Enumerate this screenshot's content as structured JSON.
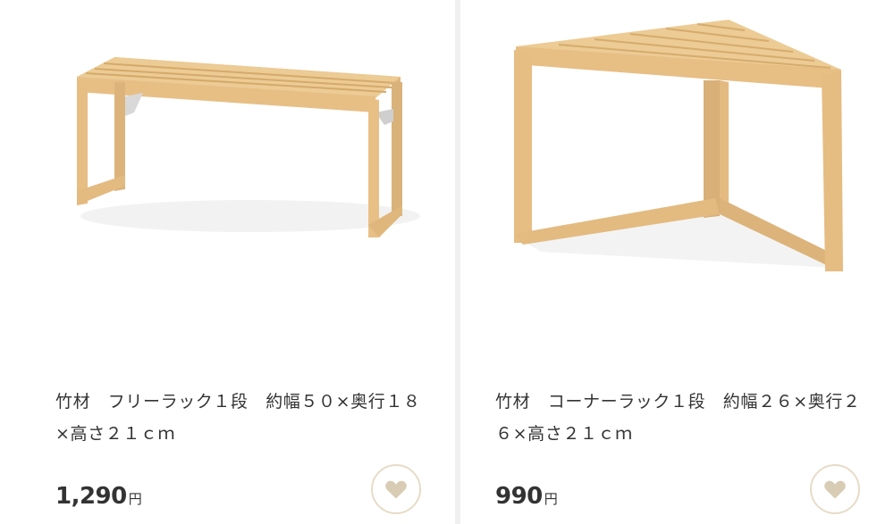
{
  "products": [
    {
      "title": "竹材　フリーラック１段　約幅５０×奥行１８×高さ２１ｃｍ",
      "price": "1,290",
      "currency": "円",
      "image_icon": "bamboo-free-rack-image",
      "favorite_icon": "heart-icon"
    },
    {
      "title": "竹材　コーナーラック１段　約幅２６×奥行２６×高さ２１ｃｍ",
      "price": "990",
      "currency": "円",
      "image_icon": "bamboo-corner-rack-image",
      "favorite_icon": "heart-icon"
    }
  ],
  "colors": {
    "bamboo": "#e9c48c",
    "bamboo_dark": "#d4a86a",
    "favorite_border": "#e6dcc8",
    "favorite_heart": "#d8ccb4",
    "divider": "#f0f0f0"
  }
}
